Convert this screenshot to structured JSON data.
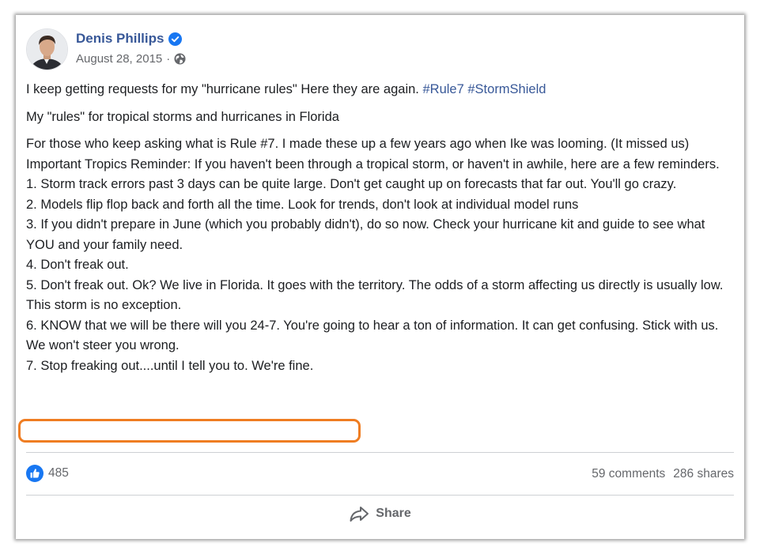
{
  "post": {
    "author": "Denis Phillips",
    "date": "August 28, 2015",
    "date_separator": "·",
    "intro_text": "I keep getting requests for my \"hurricane rules\" Here they are again. ",
    "hashtags": [
      "#Rule7",
      "#StormShield"
    ],
    "subtitle": "My \"rules\" for tropical storms and hurricanes in Florida",
    "lines": [
      "For those who keep asking what is Rule #7. I made these up a few years ago when Ike was looming. (It missed us)",
      "Important Tropics Reminder: If you haven't been through a tropical storm, or haven't in awhile, here are a few reminders.",
      "1. Storm track errors past 3 days can be quite large. Don't get caught up on forecasts that far out. You'll go crazy.",
      "2. Models flip flop back and forth all the time. Look for trends, don't look at individual model runs",
      "3. If you didn't prepare in June (which you probably didn't), do so now. Check your hurricane kit and guide to see what YOU and your family need.",
      "4. Don't freak out.",
      "5. Don't freak out. Ok? We live in Florida. It goes with the territory. The odds of a storm affecting us directly is usually low. This storm is no exception.",
      "6. KNOW that we will be there will you 24-7. You're going to hear a ton of information. It can get confusing. Stick with us. We won't steer you wrong.",
      "7. Stop freaking out....until I tell you to. We're fine."
    ]
  },
  "engagement": {
    "likes": "485",
    "comments": "59 comments",
    "shares": "286 shares",
    "share_label": "Share"
  },
  "colors": {
    "link": "#385898",
    "highlight": "#ef7d22",
    "like": "#1877f2"
  }
}
